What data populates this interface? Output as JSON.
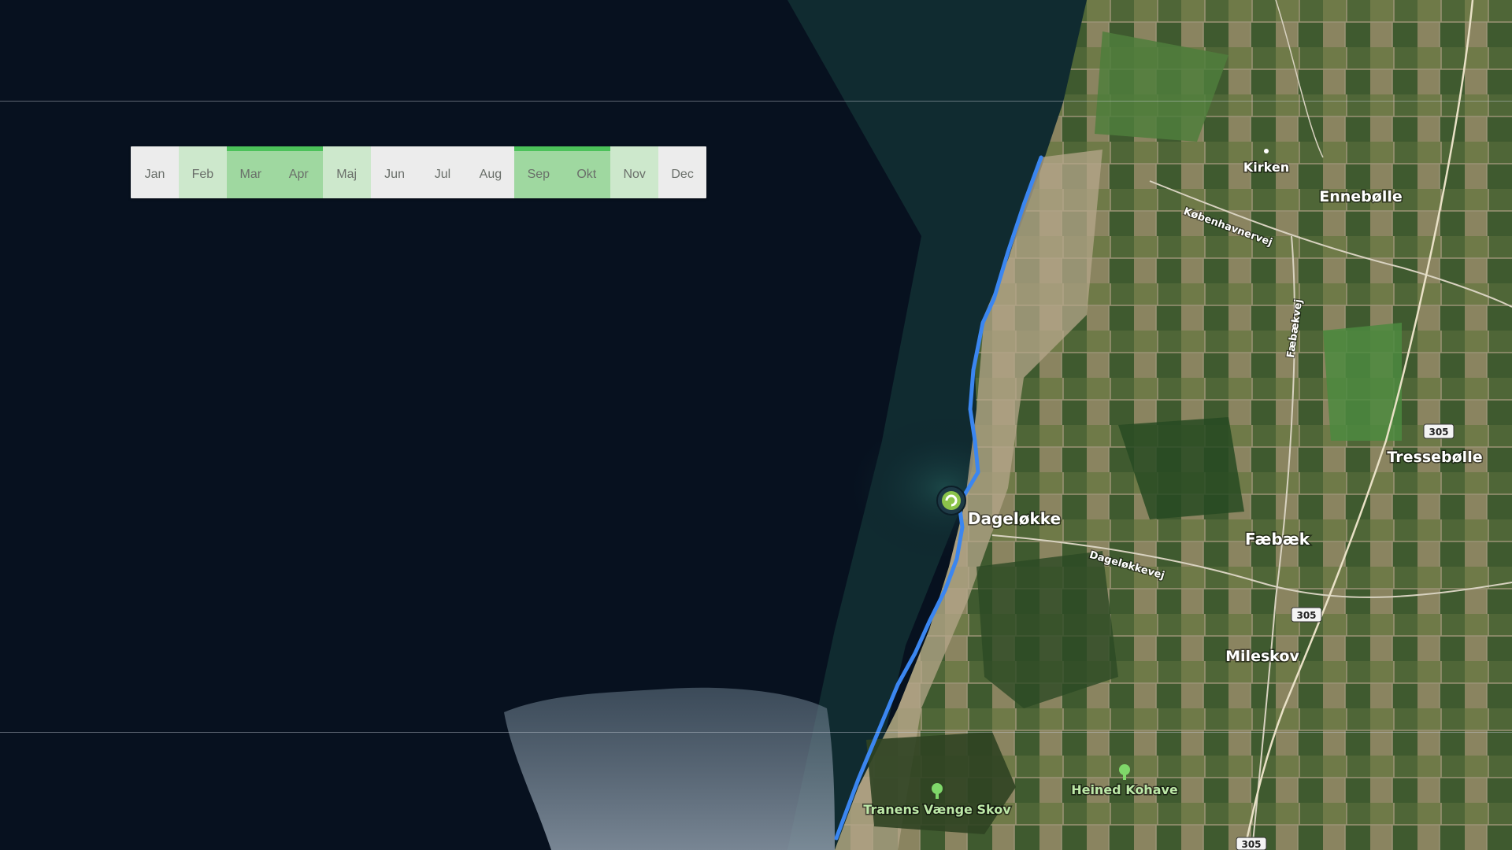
{
  "season": {
    "months": [
      {
        "label": "Jan",
        "level": 0
      },
      {
        "label": "Feb",
        "level": 1
      },
      {
        "label": "Mar",
        "level": 2
      },
      {
        "label": "Apr",
        "level": 2
      },
      {
        "label": "Maj",
        "level": 1
      },
      {
        "label": "Jun",
        "level": 0
      },
      {
        "label": "Jul",
        "level": 0
      },
      {
        "label": "Aug",
        "level": 0
      },
      {
        "label": "Sep",
        "level": 2
      },
      {
        "label": "Okt",
        "level": 2
      },
      {
        "label": "Nov",
        "level": 1
      },
      {
        "label": "Dec",
        "level": 0
      }
    ]
  },
  "map": {
    "places": {
      "kirken": "Kirken",
      "ennebolle": "Ennebølle",
      "tressebolle": "Tressebølle",
      "faebaek": "Fæbæk",
      "mileskov": "Mileskov",
      "dagelokke": "Dageløkke"
    },
    "roads": {
      "kobenhavnervej": "Københavnervej",
      "faebaekvej": "Fæbækvej",
      "dagelokkevej": "Dageløkkevej"
    },
    "parks": {
      "heined": "Heined Kohave",
      "tranens": "Tranens Vænge Skov"
    },
    "shields": {
      "s1": "305",
      "s2": "305",
      "s3": "305"
    },
    "colors": {
      "sea": "#07111f",
      "coast_route": "#3b86f0",
      "marker": "#8bc34a"
    }
  }
}
